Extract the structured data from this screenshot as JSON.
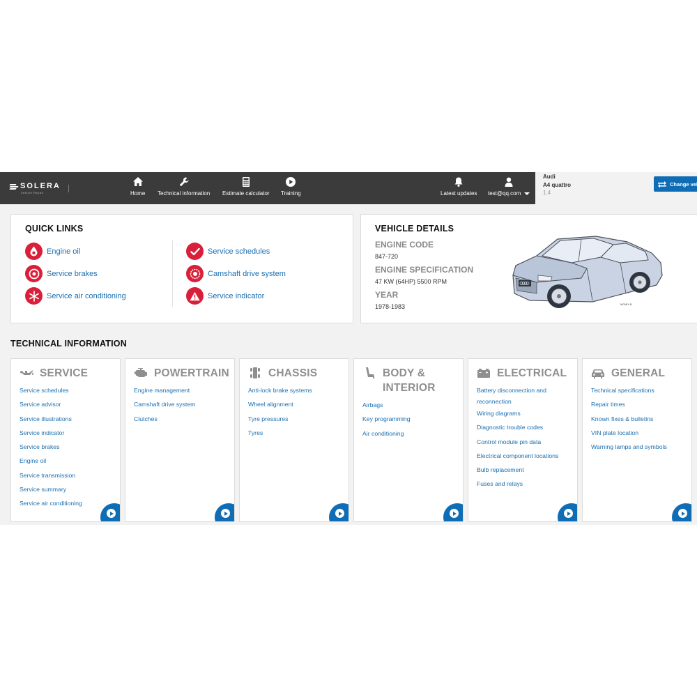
{
  "brand": {
    "name": "SOLERA",
    "sub": "Vehicle Repair"
  },
  "nav": [
    {
      "label": "Home",
      "icon": "home-icon"
    },
    {
      "label": "Technical information",
      "icon": "wrench-icon"
    },
    {
      "label": "Estimate calculator",
      "icon": "calculator-icon"
    },
    {
      "label": "Training",
      "icon": "play-icon"
    }
  ],
  "updates": {
    "label": "Latest updates",
    "icon": "bell-icon"
  },
  "user": {
    "label": "test@qq.com",
    "icon": "user-icon"
  },
  "vehicle": {
    "make": "Audi",
    "model": "A4 quattro",
    "engine": "1.4"
  },
  "change_button": {
    "label": "Change vel",
    "icon": "swap-icon"
  },
  "quick_links": {
    "title": "QUICK LINKS",
    "items": [
      {
        "label": "Engine oil",
        "icon": "oil-drop-icon"
      },
      {
        "label": "Service brakes",
        "icon": "brake-disc-icon"
      },
      {
        "label": "Service air conditioning",
        "icon": "snowflake-icon"
      },
      {
        "label": "Service schedules",
        "icon": "checkmark-icon"
      },
      {
        "label": "Camshaft drive system",
        "icon": "camshaft-icon"
      },
      {
        "label": "Service indicator",
        "icon": "warning-icon"
      }
    ]
  },
  "vehicle_details": {
    "title": "VEHICLE DETAILS",
    "engine_code_label": "ENGINE CODE",
    "engine_code": "847-720",
    "engine_spec_label": "ENGINE SPECIFICATION",
    "engine_spec": "47 KW (64HP) 5500 RPM",
    "year_label": "YEAR",
    "year": "1978-1983",
    "image_ref": "M0081-B"
  },
  "technical_information": {
    "title": "TECHNICAL INFORMATION",
    "categories": [
      {
        "title": "SERVICE",
        "icon": "oil-can-icon",
        "links": [
          "Service schedules",
          "Service advisor",
          "Service illustrations",
          "Service indicator",
          "Service brakes",
          "Engine oil",
          "Service transmission",
          "Service summary",
          "Service air conditioning"
        ]
      },
      {
        "title": "POWERTRAIN",
        "icon": "engine-icon",
        "links": [
          "Engine management",
          "Camshaft drive system",
          "Clutches"
        ]
      },
      {
        "title": "CHASSIS",
        "icon": "chassis-icon",
        "links": [
          "Anti-lock brake systems",
          "Wheel alignment",
          "Tyre pressures",
          "Tyres"
        ]
      },
      {
        "title": "BODY & INTERIOR",
        "title_line1": "BODY &",
        "title_line2": "INTERIOR",
        "icon": "seat-icon",
        "links": [
          "Airbags",
          "Key programming",
          "Air conditioning"
        ]
      },
      {
        "title": "ELECTRICAL",
        "icon": "battery-icon",
        "links": [
          "Battery disconnection and reconnection",
          "Wiring diagrams",
          "Diagnostic trouble codes",
          "Control module pin data",
          "Electrical component locations",
          "Bulb replacement",
          "Fuses and relays"
        ]
      },
      {
        "title": "GENERAL",
        "icon": "car-front-icon",
        "links": [
          "Technical specifications",
          "Repair times",
          "Known fixes & bulletins",
          "VIN plate location",
          "Warning lamps and symbols"
        ]
      }
    ]
  },
  "colors": {
    "topbar": "#3b3b3b",
    "accent": "#0f6db5",
    "link": "#1b6fb0",
    "quicklink_icon": "#d91f3a",
    "page_bg": "#f2f2f2"
  }
}
